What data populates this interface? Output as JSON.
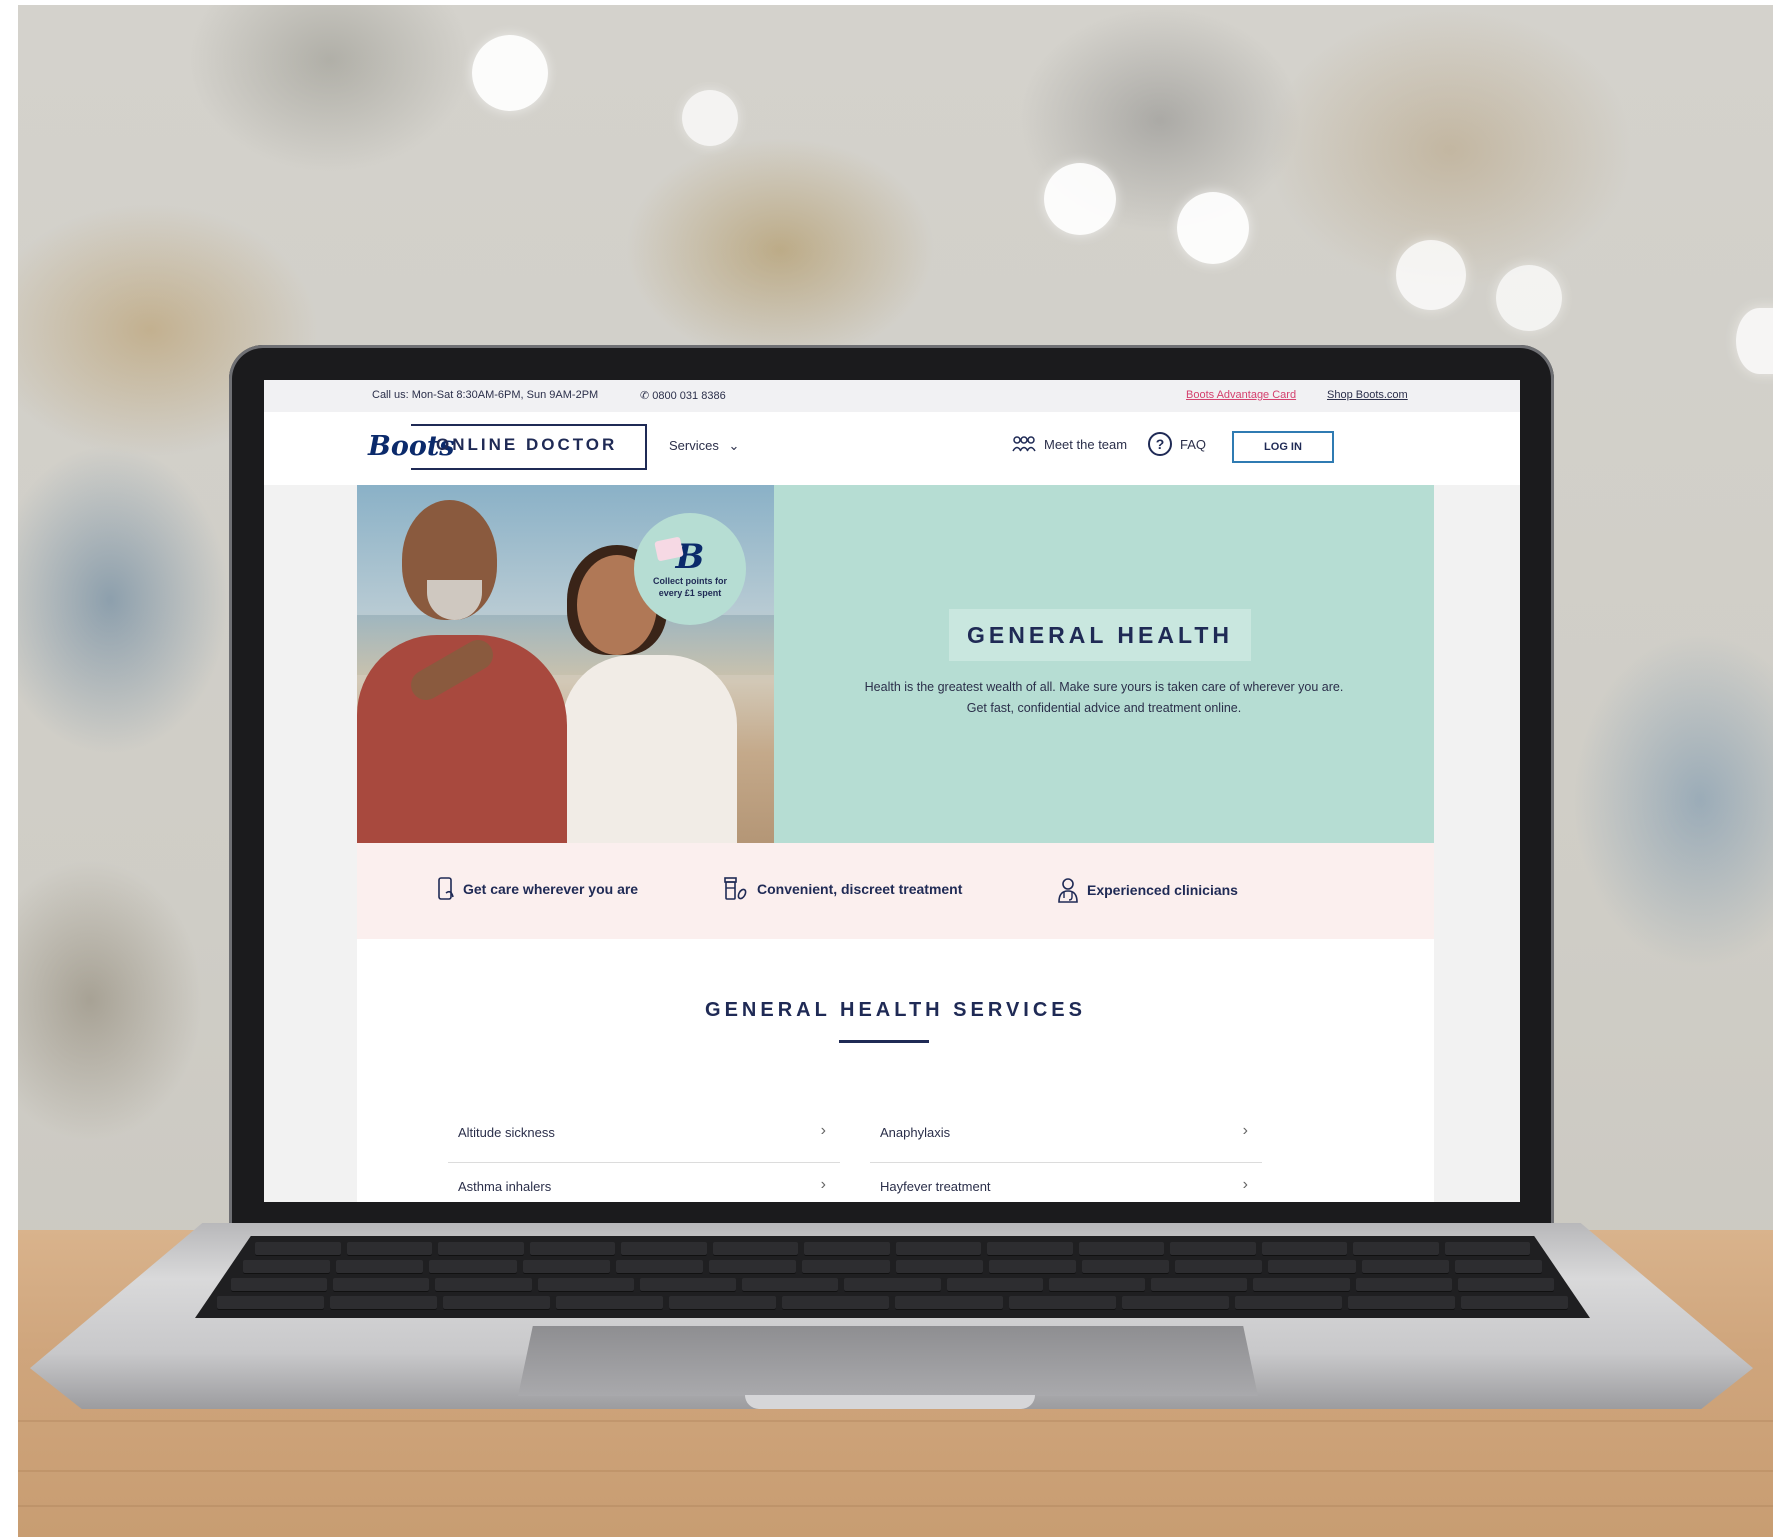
{
  "topbar": {
    "call_hours": "Call us: Mon-Sat 8:30AM-6PM, Sun 9AM-2PM",
    "phone": "0800 031 8386",
    "advantage_card": "Boots Advantage Card",
    "shop": "Shop Boots.com"
  },
  "header": {
    "logo_script": "Boots",
    "logo_text": "ONLINE DOCTOR",
    "services_label": "Services",
    "meet_team": "Meet the team",
    "faq": "FAQ",
    "login": "LOG IN"
  },
  "hero": {
    "badge_text": "Collect points for every £1 spent",
    "title": "GENERAL HEALTH",
    "description": "Health is the greatest wealth of all. Make sure yours is taken care of wherever you are. Get fast, confidential advice and treatment online."
  },
  "features": [
    {
      "label": "Get care wherever you are",
      "icon": "phone-icon"
    },
    {
      "label": "Convenient, discreet treatment",
      "icon": "pill-bottle-icon"
    },
    {
      "label": "Experienced clinicians",
      "icon": "clinician-icon"
    }
  ],
  "services_section": {
    "title": "GENERAL HEALTH SERVICES",
    "items": [
      {
        "label": "Altitude sickness"
      },
      {
        "label": "Anaphylaxis"
      },
      {
        "label": "Asthma inhalers"
      },
      {
        "label": "Hayfever treatment"
      }
    ]
  },
  "colors": {
    "navy": "#1f2a55",
    "mint": "#b6ddd3",
    "pink_link": "#d4416e",
    "blush": "#fbefee",
    "login_border": "#2f7bb2"
  }
}
